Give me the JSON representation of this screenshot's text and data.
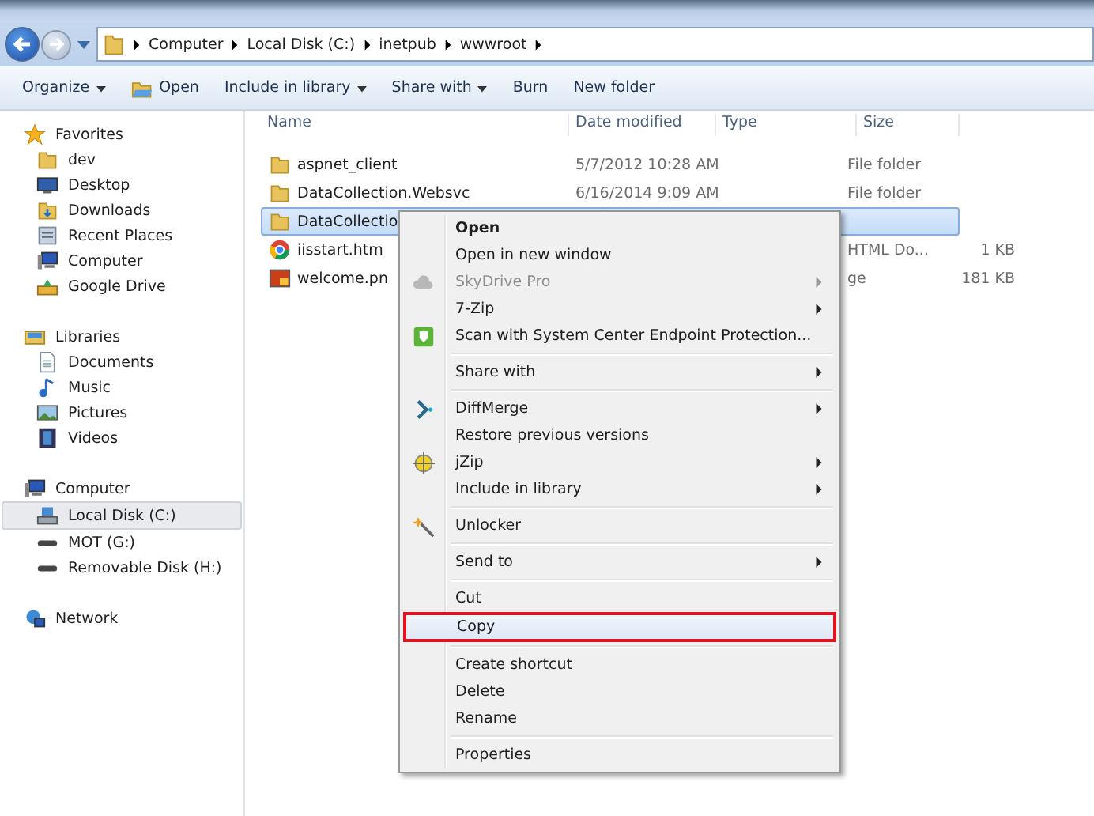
{
  "address_bar": {
    "crumbs": [
      "Computer",
      "Local Disk (C:)",
      "inetpub",
      "wwwroot"
    ]
  },
  "toolbar": [
    {
      "label": "Organize",
      "dropdown": true,
      "kind": "plain"
    },
    {
      "label": "Open",
      "dropdown": false,
      "kind": "open"
    },
    {
      "label": "Include in library",
      "dropdown": true,
      "kind": "plain"
    },
    {
      "label": "Share with",
      "dropdown": true,
      "kind": "plain"
    },
    {
      "label": "Burn",
      "dropdown": false,
      "kind": "plain"
    },
    {
      "label": "New folder",
      "dropdown": false,
      "kind": "plain"
    }
  ],
  "sidebar": {
    "sections": [
      {
        "label": "Favorites",
        "kind": "star",
        "children": [
          {
            "label": "dev",
            "kind": "folder",
            "selected": false
          },
          {
            "label": "Desktop",
            "kind": "desktop",
            "selected": false
          },
          {
            "label": "Downloads",
            "kind": "download",
            "selected": false
          },
          {
            "label": "Recent Places",
            "kind": "recent",
            "selected": false
          },
          {
            "label": "Computer",
            "kind": "computer",
            "selected": false
          },
          {
            "label": "Google Drive",
            "kind": "drive",
            "selected": false
          }
        ]
      },
      {
        "label": "Libraries",
        "kind": "library",
        "children": [
          {
            "label": "Documents",
            "kind": "document",
            "selected": false
          },
          {
            "label": "Music",
            "kind": "music",
            "selected": false
          },
          {
            "label": "Pictures",
            "kind": "picture",
            "selected": false
          },
          {
            "label": "Videos",
            "kind": "video",
            "selected": false
          }
        ]
      },
      {
        "label": "Computer",
        "kind": "computer",
        "children": [
          {
            "label": "Local Disk (C:)",
            "kind": "disk",
            "selected": true
          },
          {
            "label": "MOT (G:)",
            "kind": "removable",
            "selected": false
          },
          {
            "label": "Removable Disk (H:)",
            "kind": "removable",
            "selected": false
          }
        ]
      },
      {
        "label": "Network",
        "kind": "network"
      }
    ]
  },
  "table": {
    "columns": [
      "Name",
      "Date modified",
      "Type",
      "Size"
    ],
    "rows": [
      {
        "kind": "folder",
        "selected": false,
        "name": "aspnet_client",
        "date": "5/7/2012 10:28 AM",
        "type": "File folder"
      },
      {
        "kind": "folder",
        "selected": false,
        "name": "DataCollection.Websvc",
        "date": "6/16/2014 9:09 AM",
        "type": "File folder"
      },
      {
        "kind": "folder",
        "selected": true,
        "name": "DataCollectio"
      },
      {
        "kind": "browser",
        "selected": false,
        "name": "iisstart.htm",
        "type": "HTML Do...",
        "size": "1 KB"
      },
      {
        "kind": "image",
        "selected": false,
        "name": "welcome.pn",
        "type": "ge",
        "size": "181 KB"
      }
    ]
  },
  "context_menu": {
    "groups": [
      [
        {
          "label": "Open",
          "kind": "plain",
          "default": true,
          "disabled": false,
          "submenu": false,
          "selected": false
        },
        {
          "label": "Open in new window",
          "kind": "plain",
          "default": false,
          "disabled": false,
          "submenu": false,
          "selected": false
        },
        {
          "label": "SkyDrive Pro",
          "kind": "cloud",
          "default": false,
          "disabled": true,
          "submenu": true,
          "selected": false
        },
        {
          "label": "7-Zip",
          "kind": "plain",
          "default": false,
          "disabled": false,
          "submenu": true,
          "selected": false
        },
        {
          "label": "Scan with System Center Endpoint Protection...",
          "kind": "shield",
          "default": false,
          "disabled": false,
          "submenu": false,
          "selected": false
        }
      ],
      [
        {
          "label": "Share with",
          "kind": "plain",
          "default": false,
          "disabled": false,
          "submenu": true,
          "selected": false
        }
      ],
      [
        {
          "label": "DiffMerge",
          "kind": "chevron",
          "default": false,
          "disabled": false,
          "submenu": true,
          "selected": false
        },
        {
          "label": "Restore previous versions",
          "kind": "plain",
          "default": false,
          "disabled": false,
          "submenu": false,
          "selected": false
        },
        {
          "label": "jZip",
          "kind": "target",
          "default": false,
          "disabled": false,
          "submenu": true,
          "selected": false
        },
        {
          "label": "Include in library",
          "kind": "plain",
          "default": false,
          "disabled": false,
          "submenu": true,
          "selected": false
        }
      ],
      [
        {
          "label": "Unlocker",
          "kind": "wand",
          "default": false,
          "disabled": false,
          "submenu": false,
          "selected": false
        }
      ],
      [
        {
          "label": "Send to",
          "kind": "plain",
          "default": false,
          "disabled": false,
          "submenu": true,
          "selected": false
        }
      ],
      [
        {
          "label": "Cut",
          "kind": "plain",
          "default": false,
          "disabled": false,
          "submenu": false,
          "selected": false
        },
        {
          "label": "Copy",
          "kind": "plain",
          "default": false,
          "disabled": false,
          "submenu": false,
          "selected": true
        }
      ],
      [
        {
          "label": "Create shortcut",
          "kind": "plain",
          "default": false,
          "disabled": false,
          "submenu": false,
          "selected": false
        },
        {
          "label": "Delete",
          "kind": "plain",
          "default": false,
          "disabled": false,
          "submenu": false,
          "selected": false
        },
        {
          "label": "Rename",
          "kind": "plain",
          "default": false,
          "disabled": false,
          "submenu": false,
          "selected": false
        }
      ],
      [
        {
          "label": "Properties",
          "kind": "plain",
          "default": false,
          "disabled": false,
          "submenu": false,
          "selected": false
        }
      ]
    ]
  }
}
